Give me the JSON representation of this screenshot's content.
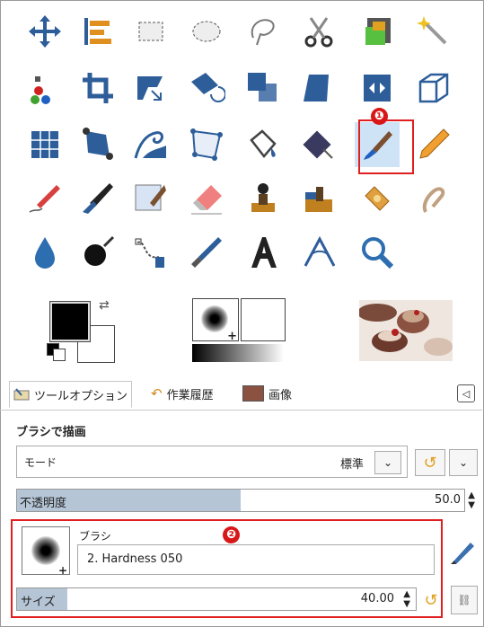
{
  "tools": [
    [
      "move-icon",
      "align-icon",
      "rect-select-icon",
      "ellipse-select-icon",
      "free-select-icon",
      "scissors-select-icon",
      "foreground-select-icon",
      "fuzzy-select-icon"
    ],
    [
      "select-by-color-icon",
      "crop-icon",
      "unified-transform-icon",
      "rotate-icon",
      "scale-icon",
      "shear-icon",
      "flip-icon",
      "perspective-cage-icon"
    ],
    [
      "perspective-icon",
      "handle-transform-icon",
      "warp-icon",
      "cage-transform-icon",
      "bucket-fill-icon",
      "gradient-icon",
      "paintbrush-icon",
      "pencil-icon"
    ],
    [
      "airbrush-icon",
      "ink-icon",
      "mypaint-brush-icon",
      "eraser-icon",
      "clone-icon",
      "heal-icon",
      "smudge-icon",
      "blur-icon"
    ],
    [
      "dodge-icon",
      "smudge-dot-icon",
      "paths-icon",
      "color-picker-icon",
      "text-icon",
      "measure-icon",
      "zoom-icon"
    ]
  ],
  "markers": {
    "one": "❶",
    "two": "❷"
  },
  "tabs": [
    "ツールオプション",
    "作業履歴",
    "画像"
  ],
  "options": {
    "tool_title": "ブラシで描画",
    "mode_label": "モード",
    "mode_value": "標準",
    "opacity_label": "不透明度",
    "opacity_value": "50.0",
    "opacity_fraction": 0.5,
    "brush_label": "ブラシ",
    "brush_name": "2. Hardness 050",
    "size_label": "サイズ",
    "size_value": "40.00"
  },
  "colors": {
    "accent": "#e02020",
    "selected": "#cfe3f6",
    "slider": "#b5c5d6"
  }
}
